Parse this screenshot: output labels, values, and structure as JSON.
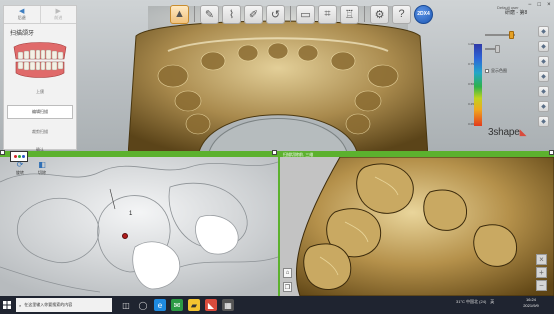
{
  "colors": {
    "accent_green": "#5cb12e",
    "logo_red": "#d94b3c",
    "taskbar": "#1f2430",
    "marker": "#b01c1c"
  },
  "left_panel": {
    "prev_label": "后退",
    "next_label": "前进",
    "title": "扫描颌牙",
    "thumbnail_caption": "上颌",
    "option_button": "编辑扫描",
    "option_text": "裁剪扫描",
    "footer_label": "确认"
  },
  "toolbar": {
    "icons": [
      "scan-icon",
      "edit-icon",
      "brush-icon",
      "pen-icon",
      "undo-icon",
      "screen-icon",
      "crop-icon",
      "tooth-icon",
      "settings-icon",
      "help-icon"
    ],
    "badge_label": "2DX4"
  },
  "user": {
    "line1": "Default user",
    "line2": "研磨 - 第8"
  },
  "window_controls": [
    "−",
    "□",
    "×"
  ],
  "color_scale": {
    "top_label": "1.00",
    "mid_label": "0.50",
    "bottom_label": "0.00",
    "labels": [
      "1.00",
      "0.75",
      "0.50",
      "0.25",
      "0.00"
    ],
    "checkbox_label": "显示色图"
  },
  "logo": {
    "text": "3shape"
  },
  "bottom_left": {
    "tools": [
      {
        "icon": "rotate-icon",
        "label": "旋转"
      },
      {
        "icon": "slice-icon",
        "label": "切除"
      }
    ],
    "marker_number": "1"
  },
  "bottom_right": {
    "header": "扫描切除前, 三维"
  },
  "taskbar": {
    "search_placeholder": "在这里输入你要搜索的内容",
    "tray": [
      "31°C 中国北 (24)",
      "英"
    ],
    "time": "16:24",
    "date": "2021/9/9"
  }
}
